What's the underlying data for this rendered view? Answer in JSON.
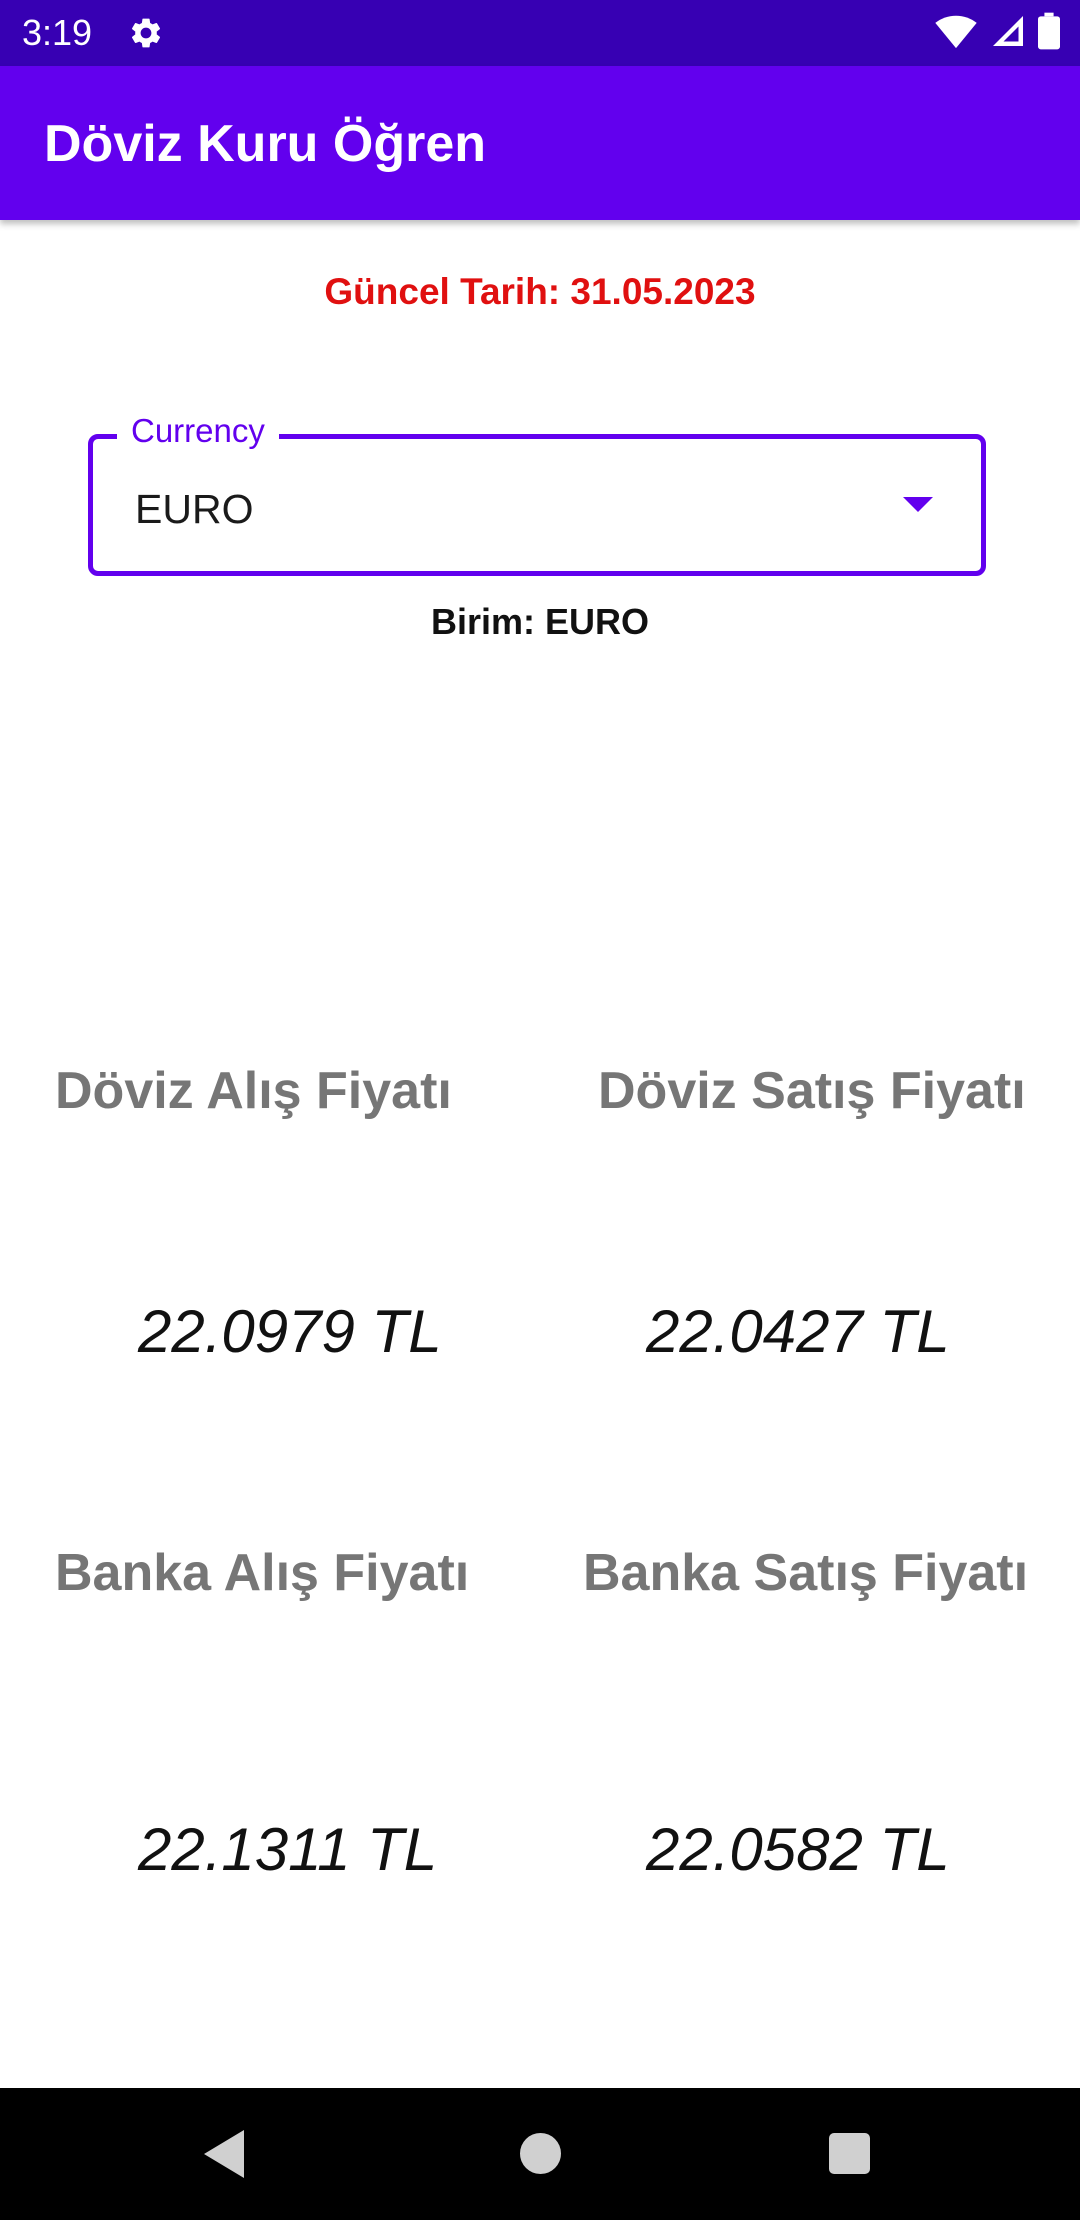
{
  "status_bar": {
    "time": "3:19",
    "icons": [
      "gear-icon",
      "wifi-icon",
      "signal-icon",
      "battery-icon"
    ]
  },
  "app_bar": {
    "title": "Döviz Kuru Öğren",
    "color": "#6200ee"
  },
  "date_text": "Güncel Tarih: 31.05.2023",
  "currency": {
    "label": "Currency",
    "selected": "EURO"
  },
  "unit_text": "Birim: EURO",
  "prices": {
    "doviz_alis": {
      "title": "Döviz Alış Fiyatı",
      "value": "22.0979 TL"
    },
    "doviz_satis": {
      "title": "Döviz Satış Fiyatı",
      "value": "22.0427 TL"
    },
    "banka_alis": {
      "title": "Banka Alış Fiyatı",
      "value": "22.1311 TL"
    },
    "banka_satis": {
      "title": "Banka Satış Fiyatı",
      "value": "22.0582 TL"
    }
  },
  "colors": {
    "primary": "#6200ee",
    "primary_dark": "#3700b3",
    "date_red": "#e01010",
    "title_gray": "#767676"
  },
  "nav_bar": {
    "icons": [
      "back-icon",
      "home-icon",
      "recents-icon"
    ]
  }
}
